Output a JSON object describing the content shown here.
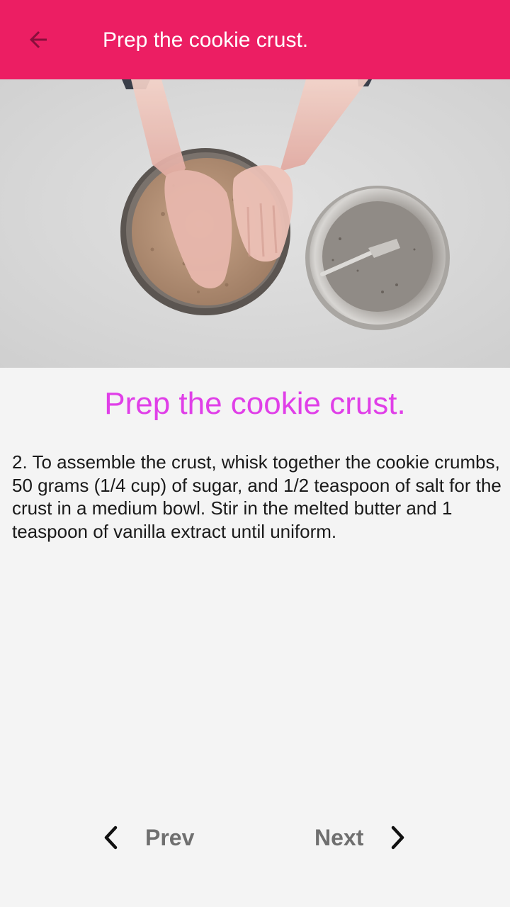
{
  "app_bar": {
    "title": "Prep the cookie crust.",
    "background_color": "#ec1e63",
    "back_icon": "arrow-back-icon"
  },
  "media": {
    "type": "video-frame",
    "subject": "hands pressing cookie crumb crust into a springform pan beside a metal mixing bowl with a fork"
  },
  "step": {
    "title": "Prep the cookie crust.",
    "title_color": "#e03fe8",
    "description": "2. To assemble the crust, whisk together the cookie crumbs, 50 grams (1/4 cup) of sugar, and 1/2 teaspoon of salt for the crust in a medium bowl. Stir in the melted butter and 1 teaspoon of vanilla extract until uniform."
  },
  "navigation": {
    "prev_label": "Prev",
    "next_label": "Next",
    "prev_icon": "chevron-left-icon",
    "next_icon": "chevron-right-icon"
  }
}
